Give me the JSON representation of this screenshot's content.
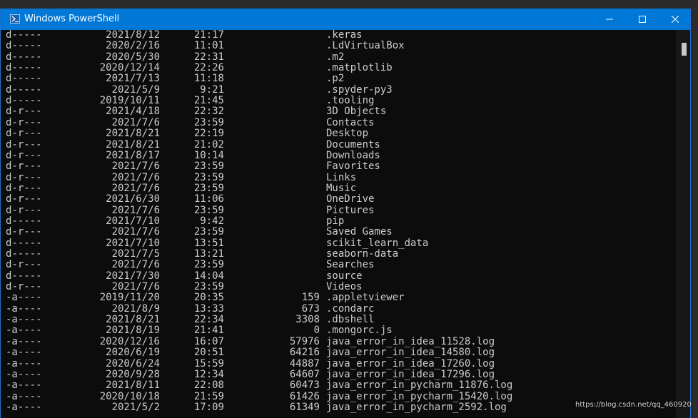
{
  "window": {
    "title": "Windows PowerShell",
    "icon": "powershell-icon",
    "controls": [
      "minimize-icon",
      "maximize-icon",
      "close-icon"
    ],
    "accent_color": "#0078d7"
  },
  "listing": [
    {
      "mode": "d-----",
      "date": "2021/8/12",
      "time": "21:17",
      "length": "",
      "name": ".keras"
    },
    {
      "mode": "d-----",
      "date": "2020/2/16",
      "time": "11:01",
      "length": "",
      "name": ".LdVirtualBox"
    },
    {
      "mode": "d-----",
      "date": "2020/5/30",
      "time": "22:31",
      "length": "",
      "name": ".m2"
    },
    {
      "mode": "d-----",
      "date": "2020/12/14",
      "time": "22:26",
      "length": "",
      "name": ".matplotlib"
    },
    {
      "mode": "d-----",
      "date": "2021/7/13",
      "time": "11:18",
      "length": "",
      "name": ".p2"
    },
    {
      "mode": "d-----",
      "date": "2021/5/9",
      "time": "9:21",
      "length": "",
      "name": ".spyder-py3"
    },
    {
      "mode": "d-----",
      "date": "2019/10/11",
      "time": "21:45",
      "length": "",
      "name": ".tooling"
    },
    {
      "mode": "d-r---",
      "date": "2021/4/18",
      "time": "22:32",
      "length": "",
      "name": "3D Objects"
    },
    {
      "mode": "d-r---",
      "date": "2021/7/6",
      "time": "23:59",
      "length": "",
      "name": "Contacts"
    },
    {
      "mode": "d-r---",
      "date": "2021/8/21",
      "time": "22:19",
      "length": "",
      "name": "Desktop"
    },
    {
      "mode": "d-r---",
      "date": "2021/8/21",
      "time": "21:02",
      "length": "",
      "name": "Documents"
    },
    {
      "mode": "d-r---",
      "date": "2021/8/17",
      "time": "10:14",
      "length": "",
      "name": "Downloads"
    },
    {
      "mode": "d-r---",
      "date": "2021/7/6",
      "time": "23:59",
      "length": "",
      "name": "Favorites"
    },
    {
      "mode": "d-r---",
      "date": "2021/7/6",
      "time": "23:59",
      "length": "",
      "name": "Links"
    },
    {
      "mode": "d-r---",
      "date": "2021/7/6",
      "time": "23:59",
      "length": "",
      "name": "Music"
    },
    {
      "mode": "d-r---",
      "date": "2021/6/30",
      "time": "11:06",
      "length": "",
      "name": "OneDrive"
    },
    {
      "mode": "d-r---",
      "date": "2021/7/6",
      "time": "23:59",
      "length": "",
      "name": "Pictures"
    },
    {
      "mode": "d-----",
      "date": "2021/7/10",
      "time": "9:42",
      "length": "",
      "name": "pip"
    },
    {
      "mode": "d-r---",
      "date": "2021/7/6",
      "time": "23:59",
      "length": "",
      "name": "Saved Games"
    },
    {
      "mode": "d-----",
      "date": "2021/7/10",
      "time": "13:51",
      "length": "",
      "name": "scikit_learn_data"
    },
    {
      "mode": "d-----",
      "date": "2021/7/5",
      "time": "13:21",
      "length": "",
      "name": "seaborn-data"
    },
    {
      "mode": "d-r---",
      "date": "2021/7/6",
      "time": "23:59",
      "length": "",
      "name": "Searches"
    },
    {
      "mode": "d-----",
      "date": "2021/7/30",
      "time": "14:04",
      "length": "",
      "name": "source"
    },
    {
      "mode": "d-r---",
      "date": "2021/7/6",
      "time": "23:59",
      "length": "",
      "name": "Videos"
    },
    {
      "mode": "-a----",
      "date": "2019/11/20",
      "time": "20:35",
      "length": "159",
      "name": ".appletviewer"
    },
    {
      "mode": "-a----",
      "date": "2021/8/9",
      "time": "13:33",
      "length": "673",
      "name": ".condarc"
    },
    {
      "mode": "-a----",
      "date": "2021/8/21",
      "time": "22:34",
      "length": "3308",
      "name": ".dbshell"
    },
    {
      "mode": "-a----",
      "date": "2021/8/19",
      "time": "21:41",
      "length": "0",
      "name": ".mongorc.js"
    },
    {
      "mode": "-a----",
      "date": "2020/12/16",
      "time": "16:07",
      "length": "57976",
      "name": "java_error_in_idea_11528.log"
    },
    {
      "mode": "-a----",
      "date": "2020/6/19",
      "time": "20:51",
      "length": "64216",
      "name": "java_error_in_idea_14580.log"
    },
    {
      "mode": "-a----",
      "date": "2020/6/24",
      "time": "15:59",
      "length": "44887",
      "name": "java_error_in_idea_17260.log"
    },
    {
      "mode": "-a----",
      "date": "2020/9/28",
      "time": "12:34",
      "length": "64607",
      "name": "java_error_in_idea_17296.log"
    },
    {
      "mode": "-a----",
      "date": "2021/8/11",
      "time": "22:08",
      "length": "60473",
      "name": "java_error_in_pycharm_11876.log"
    },
    {
      "mode": "-a----",
      "date": "2020/10/18",
      "time": "21:59",
      "length": "61426",
      "name": "java_error_in_pycharm_15420.log"
    },
    {
      "mode": "-a----",
      "date": "2021/5/2",
      "time": "17:09",
      "length": "61349",
      "name": "java_error_in_pycharm_2592.log"
    }
  ],
  "watermark": "https://blog.csdn.net/qq_460920"
}
